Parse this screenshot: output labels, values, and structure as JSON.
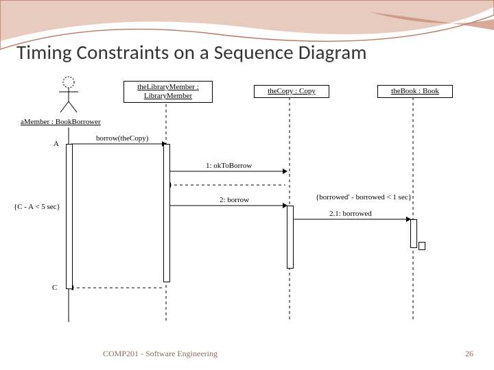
{
  "title": "Timing Constraints on a Sequence Diagram",
  "footer": {
    "left": "COMP201 - Software Engineering",
    "page": "26"
  },
  "diagram": {
    "actor_label": "aMember : BookBorrower",
    "participants": {
      "p1_line1": "theLibraryMember :",
      "p1_line2": "LibraryMember",
      "p2": "theCopy : Copy",
      "p3": "theBook : Book"
    },
    "marks": {
      "A": "A",
      "C": "C"
    },
    "constraints": {
      "left": "{C - A < 5 sec}",
      "right": "{borrowed' - borrowed < 1 sec}"
    },
    "messages": {
      "m_borrow": "borrow(theCopy)",
      "m1": "1: okToBorrow",
      "m2": "2: borrow",
      "m21": "2.1: borrowed"
    }
  }
}
